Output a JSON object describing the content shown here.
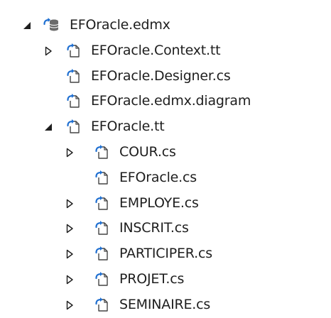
{
  "tree": {
    "nodes": [
      {
        "label": "EFOracle.edmx",
        "depth": 0,
        "expander": "expanded",
        "icon": "edmx-model-icon"
      },
      {
        "label": "EFOracle.Context.tt",
        "depth": 1,
        "expander": "collapsed",
        "icon": "template-file-icon"
      },
      {
        "label": "EFOracle.Designer.cs",
        "depth": 1,
        "expander": "none",
        "icon": "template-file-icon"
      },
      {
        "label": "EFOracle.edmx.diagram",
        "depth": 1,
        "expander": "none",
        "icon": "template-file-icon"
      },
      {
        "label": "EFOracle.tt",
        "depth": 1,
        "expander": "expanded",
        "icon": "template-file-icon"
      },
      {
        "label": "COUR.cs",
        "depth": 2,
        "expander": "collapsed",
        "icon": "template-file-icon"
      },
      {
        "label": "EFOracle.cs",
        "depth": 2,
        "expander": "none",
        "icon": "template-file-icon"
      },
      {
        "label": "EMPLOYE.cs",
        "depth": 2,
        "expander": "collapsed",
        "icon": "template-file-icon"
      },
      {
        "label": "INSCRIT.cs",
        "depth": 2,
        "expander": "collapsed",
        "icon": "template-file-icon"
      },
      {
        "label": "PARTICIPER.cs",
        "depth": 2,
        "expander": "collapsed",
        "icon": "template-file-icon"
      },
      {
        "label": "PROJET.cs",
        "depth": 2,
        "expander": "collapsed",
        "icon": "template-file-icon"
      },
      {
        "label": "SEMINAIRE.cs",
        "depth": 2,
        "expander": "collapsed",
        "icon": "template-file-icon"
      }
    ]
  },
  "colors": {
    "text": "#1e1e1e",
    "expander": "#1e1e1e",
    "file_arrow": "#1f6fd1",
    "file_outline": "#444444",
    "db_icon": "#6b6b6b"
  }
}
